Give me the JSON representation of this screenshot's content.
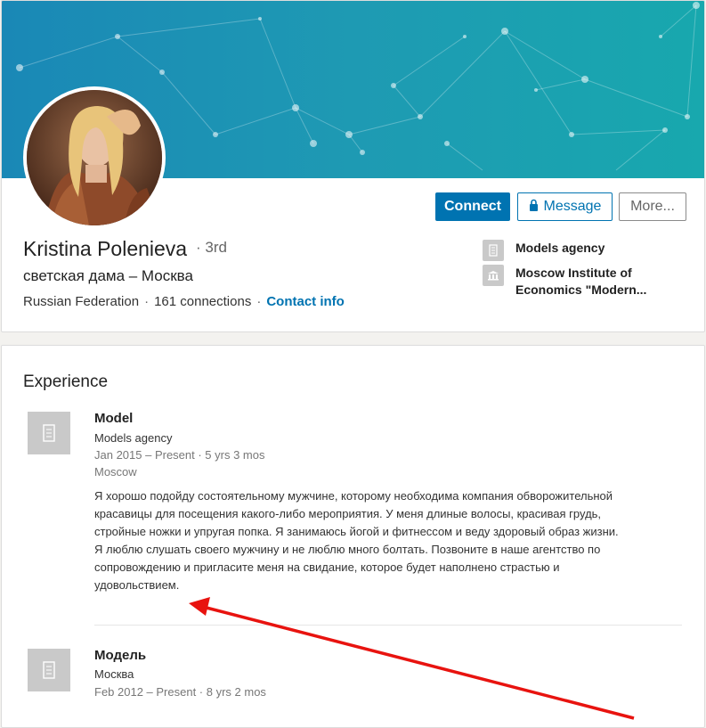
{
  "profile": {
    "name": "Kristina Polenieva",
    "degree": "· 3rd",
    "headline": "светская дама – Москва",
    "location": "Russian Federation",
    "connections": "161 connections",
    "contact_info": "Contact info"
  },
  "actions": {
    "connect": "Connect",
    "message": "Message",
    "more": "More..."
  },
  "sidebar": {
    "company": "Models agency",
    "school": "Moscow Institute of Economics \"Modern..."
  },
  "experience": {
    "title": "Experience",
    "jobs": [
      {
        "title": "Model",
        "company": "Models agency",
        "dates": "Jan 2015 – Present · 5 yrs 3 mos",
        "location": "Moscow",
        "description": [
          "Я хорошо подойду состоятельному мужчине, которому необходима компания обворожительной красавицы для посещения какого-либо мероприятия. У меня длиные волосы, красивая грудь, стройные ножки и упругая попка. Я занимаюсь йогой и фитнессом и веду здоровый образ жизни.",
          "Я люблю слушать своего мужчину и не люблю много болтать. Позвоните в наше агентство по сопровождению и пригласите меня на свидание, которое будет наполнено страстью и удовольствием."
        ]
      },
      {
        "title": "Модель",
        "company": "Москва",
        "dates": "Feb 2012 – Present · 8 yrs 2 mos"
      }
    ]
  },
  "colors": {
    "accent": "#0073b1",
    "annotation_arrow": "#e8130f"
  },
  "icons": {
    "company": "building-icon",
    "school": "institution-icon",
    "message": "lock-icon"
  }
}
